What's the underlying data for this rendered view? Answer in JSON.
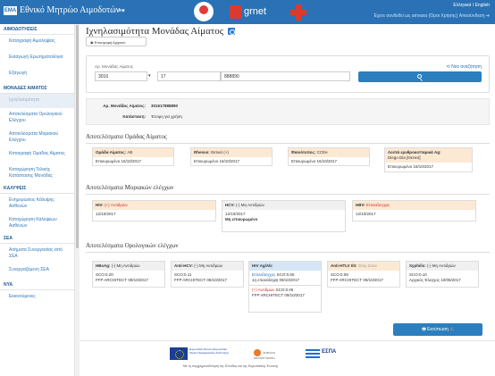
{
  "header": {
    "logo_text": "EMA",
    "app_title": "Εθνικό Μητρώο Αιμοδοτών",
    "menu_caret": "≡▾",
    "grnet_text": "grnet",
    "lang": "Ελληνικά / English",
    "user_info": "Έχετε συνδεθεί ως amvaso (Όροι Χρήσης) Αποσύνδεση ➔"
  },
  "sidebar": {
    "sections": [
      {
        "title": "ΑΙΜΟΔΟΤΗΣΕΙΣ",
        "items": [
          {
            "label": "Καταγραφή Αιμοληψίας",
            "active": false
          },
          {
            "label": "Εισαγωγή Ερωτηματολόγια",
            "active": false
          },
          {
            "label": "Εξαγωγή",
            "active": false
          }
        ]
      },
      {
        "title": "ΜΟΝΑΔΕΣ ΑΙΜΑΤΟΣ",
        "items": [
          {
            "label": "Ιχνηλασιμότητα",
            "active": true
          },
          {
            "label": "Αποτελέσματα Ορολογικού Ελέγχου",
            "active": false
          },
          {
            "label": "Αποτελέσματα Μοριακού Ελέγχου",
            "active": false
          },
          {
            "label": "Καταγραφή Ομάδας Αίματος",
            "active": false
          },
          {
            "label": "Καταχώρηση Τελικής Κατάστασης Μονάδας",
            "active": false
          }
        ]
      },
      {
        "title": "ΚΑΛΥΨΕΙΣ",
        "items": [
          {
            "label": "Ενημερώσεις Κάλυψης Ασθενών",
            "active": false
          },
          {
            "label": "Καταχώρηση Καλύψεων Ασθενών",
            "active": false
          }
        ]
      },
      {
        "title": "ΣΕΑ",
        "items": [
          {
            "label": "Αιτήματα Συνεργασίας από ΣΕΑ",
            "active": false
          },
          {
            "label": "Συνεργαζόμενη ΣΕΑ",
            "active": false
          }
        ]
      },
      {
        "title": "ΝΥΑ",
        "items": [
          {
            "label": "Εκκινούμενες",
            "active": false
          }
        ]
      }
    ]
  },
  "main": {
    "title": "Ιχνηλασιμότητα Μονάδας Αίματος",
    "back_button": "◉ Επιστροφή Αρχικού",
    "search": {
      "label": "Αρ. Μονάδας Αίματος",
      "field1": "3016",
      "field1_caret": "▾",
      "field2": "17",
      "field3": "888890",
      "new_search": "⟲ Νέα αναζήτηση"
    },
    "info": {
      "unit_label": "Αρ. Μονάδας Αίματος:",
      "unit_value": "301617888890",
      "status_label": "Κατάσταση:",
      "status_value": "Έτοιμη για χρήση"
    },
    "blood_group": {
      "title": "Αποτελέσματα Ομάδας Αίματος",
      "cards": [
        {
          "head_label": "Ομάδα Αίματος:",
          "head_value": "AB",
          "body": "Επικυρωμένο 16/10/2017"
        },
        {
          "head_label": "Rhesus:",
          "head_value": "Θετικό (+)",
          "body": "Επικυρωμένο 16/10/2017"
        },
        {
          "head_label": "Φαινότυπος:",
          "head_value": "CCEe",
          "body": "Επικυρωμένο 16/10/2017"
        },
        {
          "head_label": "Λοιπά ερυθροκυτταρικά Ag:",
          "head_value": "Diego Dia [Θετικό]",
          "body": "Επικυρωμένο 16/10/2017"
        }
      ]
    },
    "molecular": {
      "title": "Αποτελέσματα Μοριακών ελέγχων",
      "cards": [
        {
          "head_label": "HIV:",
          "head_value": "(+) Αντιδρών",
          "body": "12/10/2017"
        },
        {
          "head_label": "HCV:",
          "head_value": "(-) Μη Αντιδρών",
          "body": "12/10/2017",
          "body2": "Μη επικυρωμένο"
        },
        {
          "head_label": "HBV:",
          "head_value": "Επανέλεγχος",
          "body": "12/10/2017"
        }
      ]
    },
    "serology": {
      "title": "Αποτελέσματα Ορολογικών ελέγχων",
      "cards": [
        {
          "head_label": "HBsAg:",
          "head_value": "(-) Μη Αντιδρών",
          "line1": "SCO:0.20",
          "line2": "FFP ARCHITECT 09/10/2017"
        },
        {
          "head_label": "Anti-HCV:",
          "head_value": "(-) Μη Αντιδρών",
          "line1": "SCO:0.11",
          "line2": "FFP ARCHITECT 09/10/2017"
        },
        {
          "head_label": "HIV Ag/Ab:",
          "line1_status": "Επανέλεγχος",
          "line1": "SCO:0.50",
          "line2": "1η επανάληψη 09/10/2017",
          "sub_status": "(+) Αντιδρών",
          "sub_line1": "SCO:0.06",
          "sub_line2": "FFP ARCHITECT 09/10/2017"
        },
        {
          "head_label": "Anti-HTLV I/II:",
          "head_value": "Gray Zone",
          "line1": "SCO:0.09",
          "line2": "FFP ARCHITECT 09/10/2017"
        },
        {
          "head_label": "Syphilis:",
          "head_value": "(-) Μη Αντιδρών",
          "line1": "SCO:0.10",
          "line2": "Αρχικός Έλεγχος 10/06/2017"
        }
      ]
    },
    "print_button": "🖶 Εκτύπωση",
    "print_warning": "⚠"
  },
  "footer": {
    "eu_text": "Ευρωπαϊκή Ένωση Ευρωπαϊκό Ταμείο Περιφερειακής Ανάπτυξης",
    "program_text": "ΨΗΦΙΑΚΗ ΜΕΤΑΡΡΥΘΜΙΣΗ",
    "espa_text": "ΕΣΠΑ",
    "text": "Με τη συγχρηματοδότηση της Ελλάδας και της Ευρωπαϊκής Ένωσης"
  }
}
